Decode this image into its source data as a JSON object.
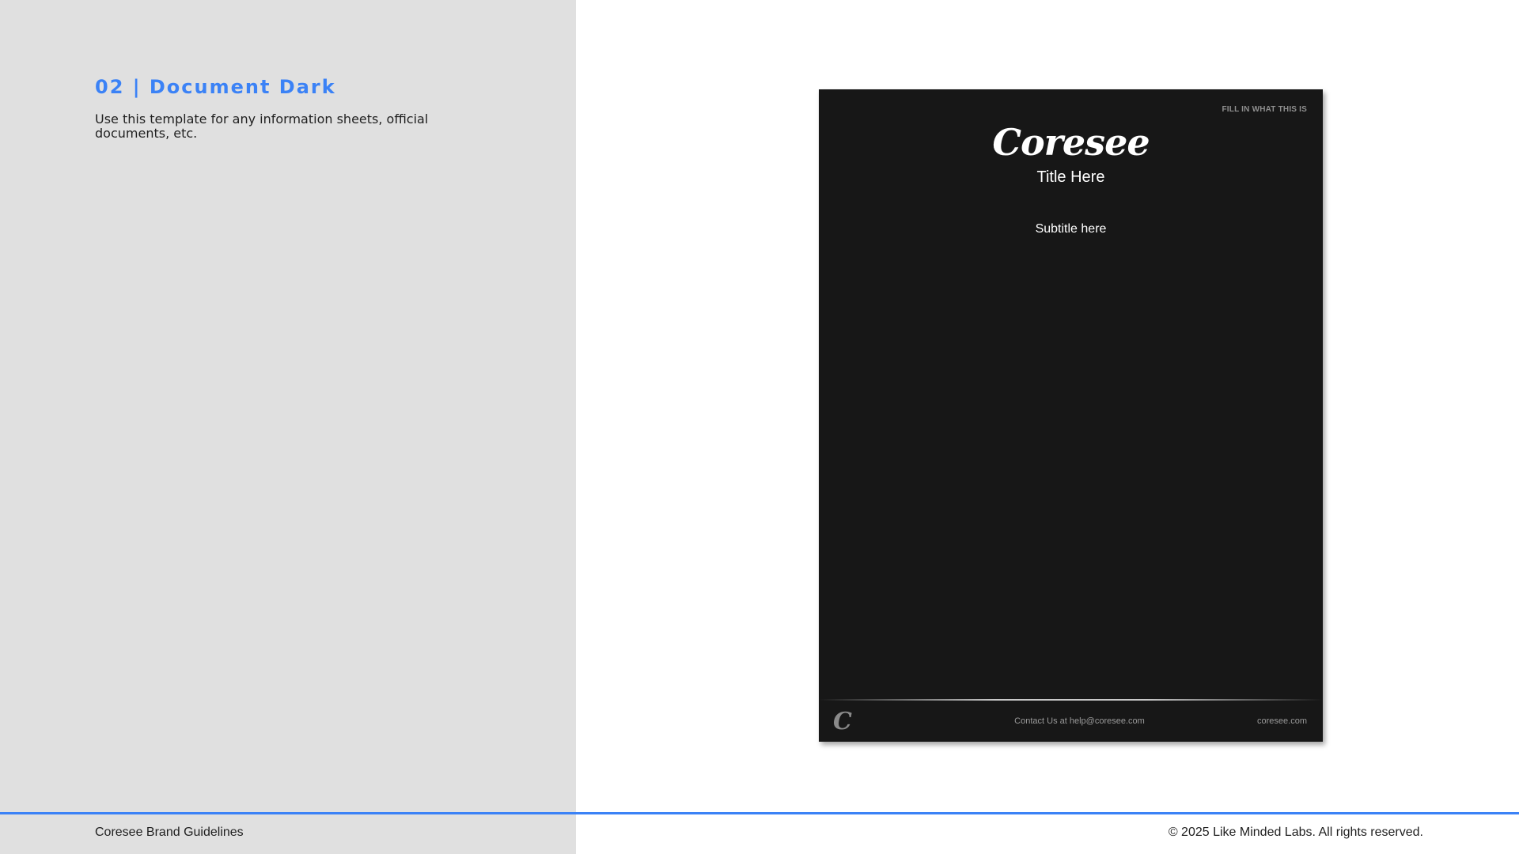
{
  "section": {
    "heading": "02 | Document Dark",
    "description": "Use this template for any information sheets, official documents, etc."
  },
  "document": {
    "corner_label": "FILL IN WHAT THIS IS",
    "logo": "Coresee",
    "title": "Title Here",
    "subtitle": "Subtitle here",
    "footer_mark": "C",
    "footer_contact": "Contact Us at help@coresee.com",
    "footer_url": "coresee.com"
  },
  "footer": {
    "left": "Coresee Brand Guidelines",
    "right": "© 2025 Like Minded Labs. All rights reserved."
  },
  "colors": {
    "accent": "#3b82f6",
    "left_panel": "#e0e0e0",
    "document_bg": "#171717"
  }
}
